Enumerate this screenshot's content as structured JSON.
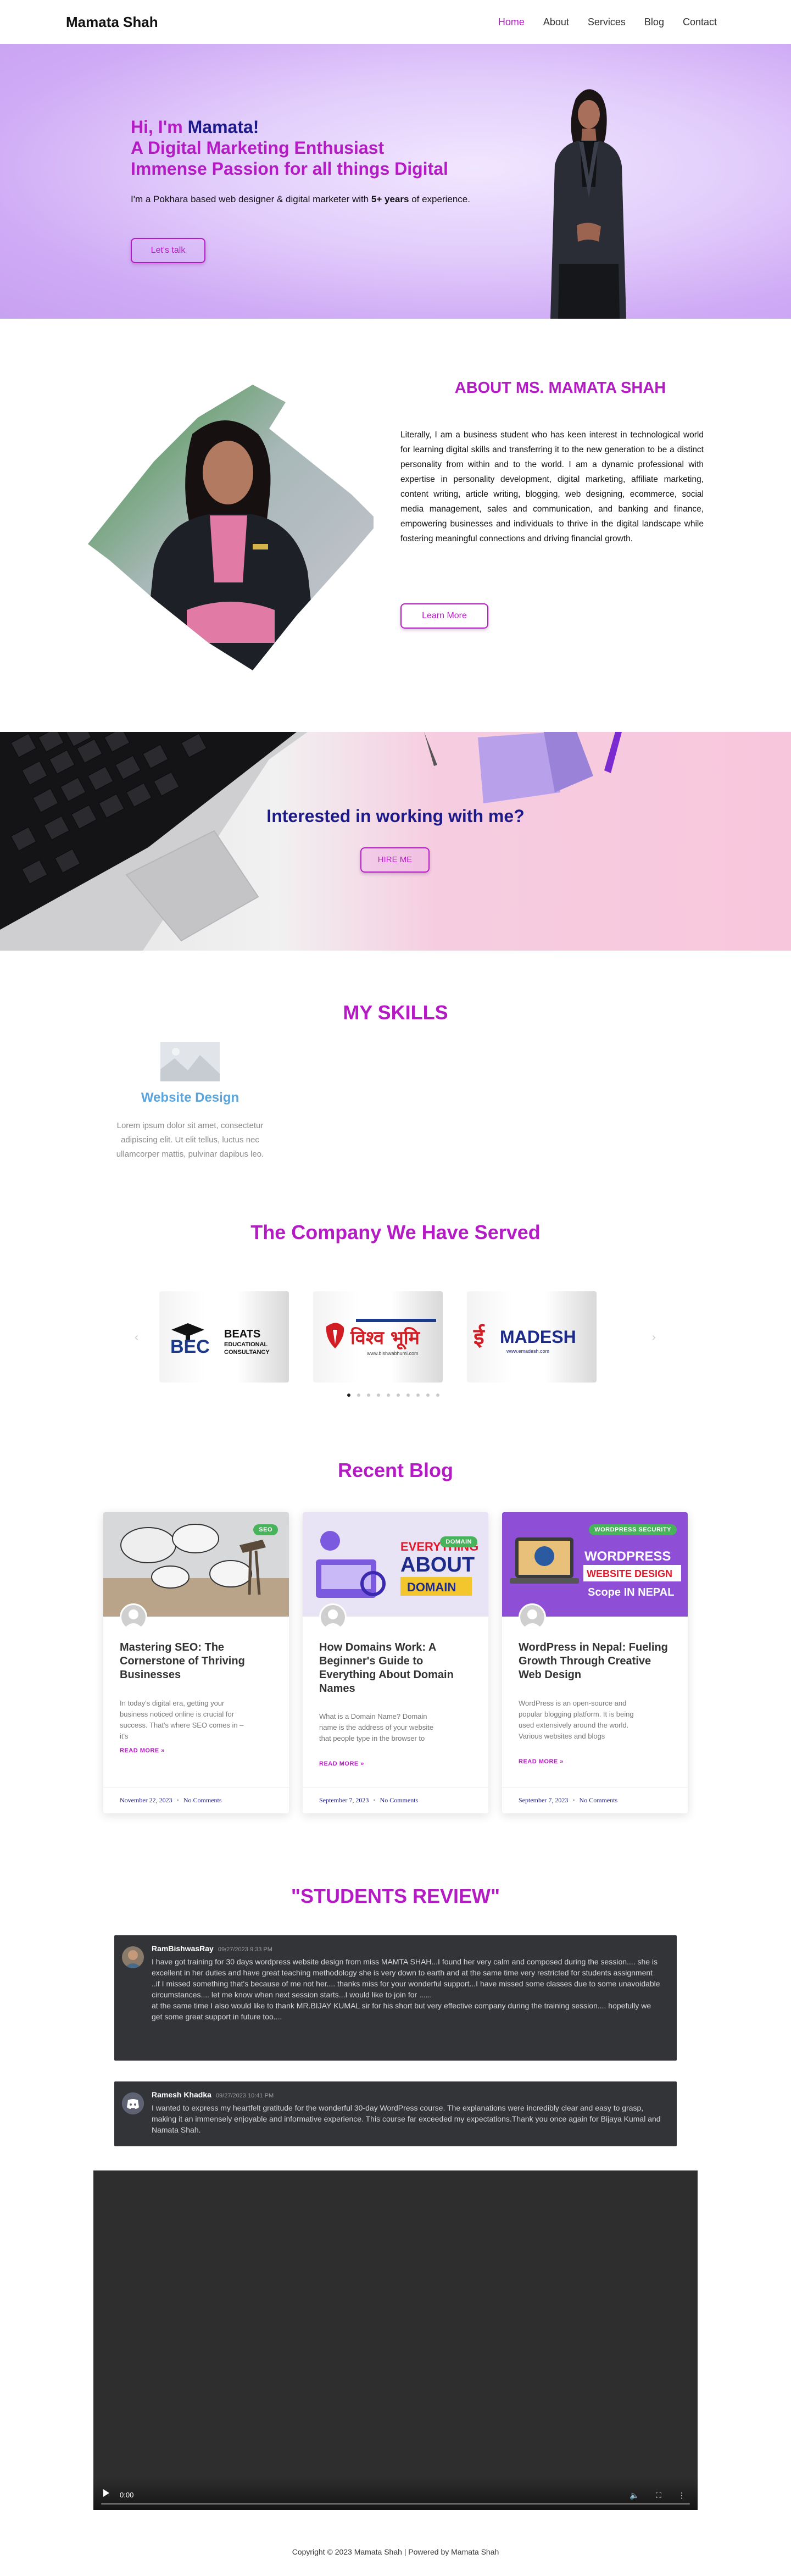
{
  "header": {
    "brand": "Mamata Shah",
    "nav": [
      {
        "label": "Home",
        "active": true
      },
      {
        "label": "About"
      },
      {
        "label": "Services"
      },
      {
        "label": "Blog"
      },
      {
        "label": "Contact"
      }
    ]
  },
  "hero": {
    "greeting_prefix": "Hi, I'm ",
    "greeting_name": "Mamata!",
    "line1": "A Digital Marketing Enthusiast",
    "line2": "Immense Passion for all things Digital",
    "desc_before": "I'm a Pokhara based web designer & digital marketer with ",
    "desc_bold": "5+ years",
    "desc_after": " of experience.",
    "button": "Let's talk"
  },
  "about": {
    "title": "ABOUT MS. MAMATA SHAH",
    "text": "Literally, I am a business student who has keen interest in technological world for learning digital skills and transferring it to the new generation to be a distinct personality from within and to the world. I am a dynamic professional with expertise in personality development, digital marketing, affiliate marketing, content writing, article writing, blogging, web designing, ecommerce, social media management, sales and communication, and banking and finance, empowering businesses and individuals to thrive in the digital landscape while fostering meaningful connections and driving financial growth.",
    "button": "Learn More"
  },
  "cta": {
    "title": "Interested in working with me?",
    "button": "HIRE ME"
  },
  "skills": {
    "title": "MY SKILLS",
    "items": [
      {
        "name": "Website Design",
        "text": "Lorem ipsum dolor sit amet, consectetur adipiscing elit. Ut elit tellus, luctus nec ullamcorper mattis, pulvinar dapibus leo."
      }
    ]
  },
  "companies": {
    "title": "The Company We Have Served",
    "logos": [
      {
        "name": "BEATS",
        "line2": "EDUCATIONAL",
        "line3": "CONSULTANCY",
        "mark": "BEC"
      },
      {
        "name": "विश्व भूमि",
        "tag": "www.bishwabhumi.com"
      },
      {
        "name": "MADESH",
        "mark": "ई",
        "tag": "www.emadesh.com"
      }
    ],
    "dots": 10,
    "active_dot": 0
  },
  "blog": {
    "title": "Recent Blog",
    "posts": [
      {
        "badge": "SEO",
        "title": "Mastering SEO: The Cornerstone of Thriving Businesses",
        "excerpt": "In today's digital era, getting your business noticed online is crucial for success. That's where SEO comes in – it's",
        "more": "READ MORE »",
        "date": "November 22, 2023",
        "comments": "No Comments"
      },
      {
        "badge": "DOMAIN",
        "title": "How Domains Work: A Beginner's Guide to Everything About Domain Names",
        "excerpt": "What is a Domain Name? Domain name is the address of your website that people type in the browser to",
        "more": "READ MORE »",
        "date": "September 7, 2023",
        "comments": "No Comments",
        "thumb_l1": "EVERYTHING",
        "thumb_l2": "ABOUT",
        "thumb_l3": "DOMAIN"
      },
      {
        "badge": "WORDPRESS SECURITY",
        "title": "WordPress in Nepal: Fueling Growth Through Creative Web Design",
        "excerpt": "WordPress is an open-source and popular blogging platform. It is being used extensively around the world. Various websites and blogs",
        "more": "READ MORE »",
        "date": "September 7, 2023",
        "comments": "No Comments",
        "thumb_l1": "WORDPRESS",
        "thumb_l2": "WEBSITE DESIGN",
        "thumb_l3": "Scope IN NEPAL"
      }
    ]
  },
  "reviews": {
    "title": "\"STUDENTS REVIEW\"",
    "items": [
      {
        "name": "RamBishwasRay",
        "time": "09/27/2023 9:33 PM",
        "text": "I have got training for 30 days wordpress website design from miss MAMTA SHAH...I found her  very calm and composed during the session.... she is excellent in her duties and have great teaching methodology she is very down to earth and at the same time very restricted for students assignment ..if I missed something that's because of me not her.... thanks miss for your wonderful support...I have missed some classes due to some unavoidable circumstances.... let me know when next session starts...I would like to join for ......\nat the same time I also would like to thank MR.BIJAY KUMAL sir for his short but very effective company during the training session.... hopefully we get  some great support in future too...."
      },
      {
        "name": "Ramesh Khadka",
        "time": "09/27/2023 10:41 PM",
        "text": "I wanted to express my heartfelt gratitude for the wonderful 30-day WordPress course. The explanations were incredibly clear and easy to grasp, making it an immensely enjoyable and informative experience. This course far exceeded my expectations.Thank you once again for Bijaya Kumal and Namata Shah."
      }
    ]
  },
  "video": {
    "time": "0:00",
    "progress": 0
  },
  "footer": {
    "text": "Copyright © 2023 Mamata Shah | Powered by Mamata Shah"
  },
  "colors": {
    "accent": "#b51bc4",
    "navy": "#1c1a8a",
    "skill_blue": "#5aa4dc"
  }
}
